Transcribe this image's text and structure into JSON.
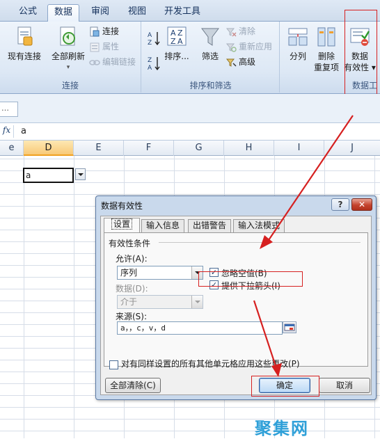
{
  "ribbon": {
    "tabs": [
      "公式",
      "数据",
      "审阅",
      "视图",
      "开发工具"
    ],
    "active_tab": "数据",
    "groups": {
      "connections": {
        "label": "连接",
        "existing": "现有连接",
        "refresh_all_line1": "全部刷新",
        "refresh_all_line2": "▾",
        "connect": "连接",
        "properties": "属性",
        "edit_links": "编辑链接"
      },
      "sort_filter": {
        "label": "排序和筛选",
        "sort": "排序...",
        "filter": "筛选",
        "clear": "清除",
        "reapply": "重新应用",
        "advanced": "高级"
      },
      "data_tools": {
        "label": "数据工",
        "split_col": "分列",
        "remove_dup_line1": "删除",
        "remove_dup_line2": "重复项",
        "validation_line1": "数据",
        "validation_line2": "有效性 ▾"
      }
    }
  },
  "formula_bar": {
    "fx_label": "fx",
    "content": "a"
  },
  "grid": {
    "columns": [
      "E_left",
      "D",
      "E",
      "F",
      "G",
      "H",
      "I",
      "J"
    ],
    "column_labels": [
      "e",
      "D",
      "E",
      "F",
      "G",
      "H",
      "I",
      "J"
    ],
    "selected_column": "D",
    "active_cell_value": "a"
  },
  "dialog": {
    "title": "数据有效性",
    "help": "?",
    "close": "✕",
    "tabs": [
      "设置",
      "输入信息",
      "出错警告",
      "输入法模式"
    ],
    "active_tab": "设置",
    "section_label": "有效性条件",
    "allow_label": "允许(A):",
    "allow_value": "序列",
    "ignore_blank_label": "忽略空值(B)",
    "ignore_blank_checked": true,
    "dropdown_label": "提供下拉箭头(I)",
    "dropdown_checked": true,
    "data_label": "数据(D):",
    "data_value": "介于",
    "source_label": "来源(S):",
    "source_value": "a，，c，v，d",
    "apply_all_label": "对有同样设置的所有其他单元格应用这些更改(P)",
    "apply_all_checked": false,
    "clear_all": "全部清除(C)",
    "ok": "确定",
    "cancel": "取消"
  },
  "watermark": "聚集网",
  "accent": {
    "annotation_red": "#d62020",
    "ribbon_blue": "#dde8f5"
  }
}
